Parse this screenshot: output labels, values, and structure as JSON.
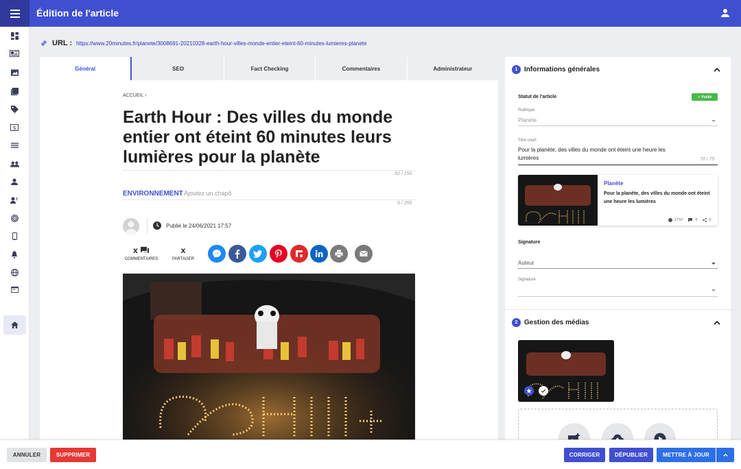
{
  "header": {
    "title": "Édition de l'article"
  },
  "url": {
    "label": "URL :",
    "value": "https://www.20minutes.fr/planete/3008691-20210328-earth-hour-villes-monde-entier-eteint-60-minutes-lumieres-planete"
  },
  "tabs": [
    {
      "label": "Général"
    },
    {
      "label": "SEO"
    },
    {
      "label": "Fact Checking"
    },
    {
      "label": "Commentaires"
    },
    {
      "label": "Administrateur"
    }
  ],
  "article": {
    "breadcrumb": "ACCUEIL ›",
    "title": "Earth Hour : Des villes du monde entier ont éteint 60 minutes leurs lumières pour la planète",
    "title_count": "92 / 150",
    "category": "ENVIRONNEMENT",
    "chapo_placeholder": "Ajoutez un chapô",
    "chapo_count": "0 / 250",
    "published": "Publié le 24/06/2021 17:57",
    "comments_count": "x",
    "comments_label": "COMMENTAIRES",
    "shares_count": "x",
    "shares_label": "PARTAGER"
  },
  "share_buttons": [
    {
      "name": "messenger-icon",
      "color": "#1e88f5"
    },
    {
      "name": "facebook-icon",
      "color": "#3b5998"
    },
    {
      "name": "twitter-icon",
      "color": "#1da1f2"
    },
    {
      "name": "pinterest-icon",
      "color": "#e60023"
    },
    {
      "name": "flipboard-icon",
      "color": "#e12828"
    },
    {
      "name": "linkedin-icon",
      "color": "#0a66c2"
    },
    {
      "name": "print-icon",
      "color": "#7a7a7a"
    },
    {
      "name": "email-icon",
      "color": "#7a7a7a"
    }
  ],
  "info_panel": {
    "number": "1",
    "title": "Informations générales",
    "status_label": "Statut de l'article",
    "status_badge": "✓ Publié",
    "rubrique_label": "Rubrique",
    "rubrique_value": "Planète",
    "short_title_label": "Titre court",
    "short_title_value": "Pour la planète, des villes du monde ont éteint une heure les lumières",
    "short_title_count": "70 / 75",
    "preview": {
      "rubrique": "Planète",
      "title": "Pour la planète, des villes du monde ont éteint une heure les lumières",
      "time": "17:57",
      "comments": "0",
      "shares": "0"
    },
    "signature_section": "Signature",
    "author_placeholder": "Auteur",
    "signature_label": "Signature"
  },
  "media_panel": {
    "number": "2",
    "title": "Gestion des médias"
  },
  "footer": {
    "cancel": "ANNULER",
    "delete": "SUPPRIMER",
    "correct": "CORRIGER",
    "unpublish": "DÉPUBLIER",
    "update": "METTRE À JOUR"
  },
  "colors": {
    "primary": "#3f4fcf",
    "danger": "#e53935",
    "success": "#48b94a",
    "update": "#2d6fe6"
  }
}
